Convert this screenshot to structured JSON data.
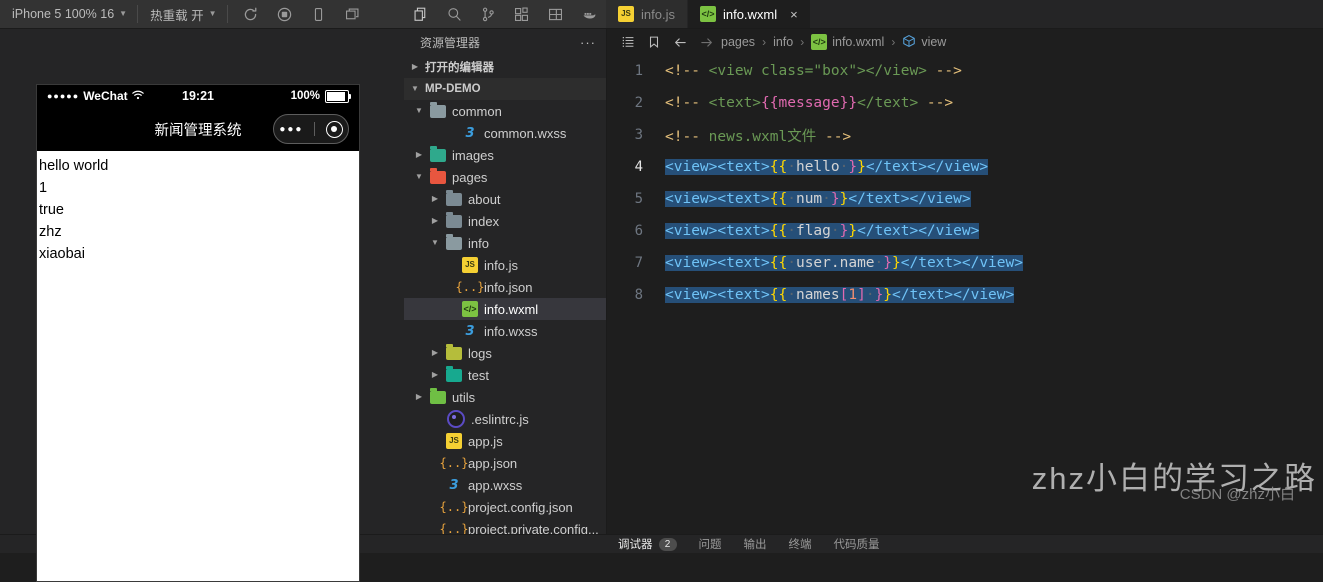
{
  "toolbar": {
    "device_select": "iPhone 5 100% 16",
    "hotreload_select": "热重载 开",
    "icons": [
      "refresh-icon",
      "record-icon",
      "phone-icon",
      "window-icon"
    ]
  },
  "activity_bar": {
    "icons": [
      "explorer-icon",
      "search-icon",
      "source-control-icon",
      "extensions-icon",
      "layout-icon",
      "docker-icon"
    ]
  },
  "tabs": [
    {
      "label": "info.js",
      "icon": "js-file-icon",
      "active": false
    },
    {
      "label": "info.wxml",
      "icon": "wxml-file-icon",
      "active": true,
      "close": "×"
    }
  ],
  "simulator": {
    "status_bar": {
      "carrier": "WeChat",
      "dots": "●●●●●",
      "wifi": "wifi-icon",
      "time": "19:21",
      "battery": "100%"
    },
    "nav_title": "新闻管理系统",
    "capsule": {
      "dots": "●●●",
      "target": "target-icon"
    },
    "page_lines": [
      "hello world",
      "1",
      "true",
      "zhz",
      "xiaobai"
    ]
  },
  "explorer": {
    "title": "资源管理器",
    "more": "···",
    "sections": [
      {
        "label": "打开的编辑器",
        "expanded": false
      },
      {
        "label": "MP-DEMO",
        "expanded": true
      }
    ],
    "tree": [
      {
        "label": "common",
        "type": "folder",
        "indent": 1,
        "arrow": "down",
        "color": "#8a9aa0"
      },
      {
        "label": "common.wxss",
        "type": "wxss",
        "indent": 3,
        "arrow": "none"
      },
      {
        "label": "images",
        "type": "folder",
        "indent": 1,
        "arrow": "right",
        "color": "#2fa98c"
      },
      {
        "label": "pages",
        "type": "folder",
        "indent": 1,
        "arrow": "down",
        "color": "#e8563f"
      },
      {
        "label": "about",
        "type": "folder",
        "indent": 2,
        "arrow": "right",
        "color": "#7b8a93"
      },
      {
        "label": "index",
        "type": "folder",
        "indent": 2,
        "arrow": "right",
        "color": "#7b8a93"
      },
      {
        "label": "info",
        "type": "folder",
        "indent": 2,
        "arrow": "down",
        "color": "#8a9aa0"
      },
      {
        "label": "info.js",
        "type": "js",
        "indent": 3,
        "arrow": "none"
      },
      {
        "label": "info.json",
        "type": "json",
        "indent": 3,
        "arrow": "none"
      },
      {
        "label": "info.wxml",
        "type": "wxml",
        "indent": 3,
        "arrow": "none",
        "selected": true
      },
      {
        "label": "info.wxss",
        "type": "wxss",
        "indent": 3,
        "arrow": "none"
      },
      {
        "label": "logs",
        "type": "folder",
        "indent": 2,
        "arrow": "right",
        "color": "#b5bd3b"
      },
      {
        "label": "test",
        "type": "folder",
        "indent": 2,
        "arrow": "right",
        "color": "#17a98f"
      },
      {
        "label": "utils",
        "type": "folder",
        "indent": 1,
        "arrow": "right",
        "color": "#6fbf44"
      },
      {
        "label": ".eslintrc.js",
        "type": "eslint",
        "indent": 2,
        "arrow": "none"
      },
      {
        "label": "app.js",
        "type": "js",
        "indent": 2,
        "arrow": "none"
      },
      {
        "label": "app.json",
        "type": "json",
        "indent": 2,
        "arrow": "none"
      },
      {
        "label": "app.wxss",
        "type": "wxss",
        "indent": 2,
        "arrow": "none"
      },
      {
        "label": "project.config.json",
        "type": "json",
        "indent": 2,
        "arrow": "none"
      },
      {
        "label": "project.private.config...",
        "type": "json",
        "indent": 2,
        "arrow": "none"
      }
    ]
  },
  "breadcrumb": {
    "icons": [
      "outline-icon",
      "bookmark-icon",
      "back-arrow-icon",
      "forward-arrow-icon"
    ],
    "items": [
      "pages",
      "info",
      "info.wxml",
      "view"
    ],
    "separator": "›"
  },
  "code": {
    "language": "wxml",
    "lines": [
      {
        "n": "1",
        "selected": false,
        "cursor": false,
        "tokens": [
          {
            "t": "<!-- ",
            "c": "cmt"
          },
          {
            "t": "<view class=\"box\"></view>",
            "c": "cmt-in"
          },
          {
            "t": " -->",
            "c": "cmt"
          }
        ]
      },
      {
        "n": "2",
        "selected": false,
        "cursor": false,
        "tokens": [
          {
            "t": "<!-- ",
            "c": "cmt"
          },
          {
            "t": "<text>",
            "c": "cmt-in"
          },
          {
            "t": "{{message}}",
            "c": "mus-p"
          },
          {
            "t": "</text>",
            "c": "cmt-in"
          },
          {
            "t": " -->",
            "c": "cmt"
          }
        ]
      },
      {
        "n": "3",
        "selected": false,
        "cursor": false,
        "tokens": [
          {
            "t": "<!-- ",
            "c": "cmt"
          },
          {
            "t": "news.wxml文件",
            "c": "cmt-in"
          },
          {
            "t": " -->",
            "c": "cmt"
          }
        ]
      },
      {
        "n": "4",
        "selected": true,
        "cursor": true,
        "tokens": [
          {
            "t": "<view><text>",
            "c": "tagb"
          },
          {
            "t": "{{",
            "c": "mus-y"
          },
          {
            "t": "·",
            "c": "sp"
          },
          {
            "t": "hello",
            "c": "expr"
          },
          {
            "t": "·",
            "c": "sp"
          },
          {
            "t": "}",
            "c": "mus-p"
          },
          {
            "t": "}",
            "c": "mus-y"
          },
          {
            "t": "</text></view>",
            "c": "tagb"
          }
        ]
      },
      {
        "n": "5",
        "selected": true,
        "cursor": false,
        "tokens": [
          {
            "t": "<view><text>",
            "c": "tagb"
          },
          {
            "t": "{{",
            "c": "mus-y"
          },
          {
            "t": "·",
            "c": "sp"
          },
          {
            "t": "num",
            "c": "expr"
          },
          {
            "t": "·",
            "c": "sp"
          },
          {
            "t": "}",
            "c": "mus-p"
          },
          {
            "t": "}",
            "c": "mus-y"
          },
          {
            "t": "</text></view>",
            "c": "tagb"
          }
        ]
      },
      {
        "n": "6",
        "selected": true,
        "cursor": false,
        "tokens": [
          {
            "t": "<view><text>",
            "c": "tagb"
          },
          {
            "t": "{{",
            "c": "mus-y"
          },
          {
            "t": "·",
            "c": "sp"
          },
          {
            "t": "flag",
            "c": "expr"
          },
          {
            "t": "·",
            "c": "sp"
          },
          {
            "t": "}",
            "c": "mus-p"
          },
          {
            "t": "}",
            "c": "mus-y"
          },
          {
            "t": "</text></view>",
            "c": "tagb"
          }
        ]
      },
      {
        "n": "7",
        "selected": true,
        "cursor": false,
        "tokens": [
          {
            "t": "<view><text>",
            "c": "tagb"
          },
          {
            "t": "{{",
            "c": "mus-y"
          },
          {
            "t": "·",
            "c": "sp"
          },
          {
            "t": "user.name",
            "c": "expr"
          },
          {
            "t": "·",
            "c": "sp"
          },
          {
            "t": "}",
            "c": "mus-p"
          },
          {
            "t": "}",
            "c": "mus-y"
          },
          {
            "t": "</text></view>",
            "c": "tagb"
          }
        ]
      },
      {
        "n": "8",
        "selected": true,
        "cursor": false,
        "tokens": [
          {
            "t": "<view><text>",
            "c": "tagb"
          },
          {
            "t": "{{",
            "c": "mus-y"
          },
          {
            "t": "·",
            "c": "sp"
          },
          {
            "t": "names",
            "c": "expr"
          },
          {
            "t": "[",
            "c": "mus-p"
          },
          {
            "t": "1",
            "c": "num"
          },
          {
            "t": "]",
            "c": "mus-p"
          },
          {
            "t": "·",
            "c": "sp"
          },
          {
            "t": "}",
            "c": "mus-p"
          },
          {
            "t": "}",
            "c": "mus-y"
          },
          {
            "t": "</text></view>",
            "c": "tagb"
          }
        ]
      }
    ]
  },
  "watermark": {
    "main": "zhz小白的学习之路",
    "credit": "CSDN @zhz小白"
  },
  "bottom_panel": {
    "tabs": [
      {
        "label": "调试器",
        "badge": "2",
        "active": true
      },
      {
        "label": "问题",
        "active": false
      },
      {
        "label": "输出",
        "active": false
      },
      {
        "label": "终端",
        "active": false
      },
      {
        "label": "代码质量",
        "active": false
      }
    ]
  },
  "colors": {
    "accent": "#264f78",
    "selection": "#37373d",
    "editor_bg": "#1e1e1e",
    "chrome_bg": "#252526"
  }
}
